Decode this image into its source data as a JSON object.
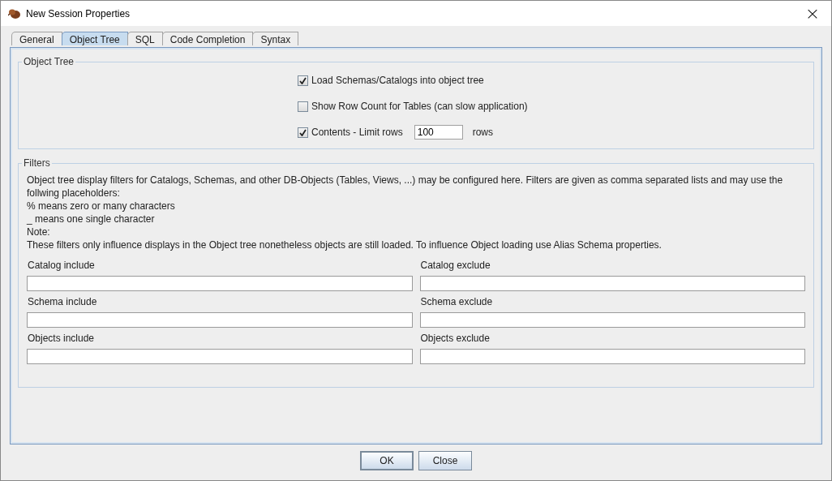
{
  "window": {
    "title": "New Session Properties",
    "close": "×"
  },
  "tabs": [
    {
      "label": "General",
      "selected": false
    },
    {
      "label": "Object Tree",
      "selected": true
    },
    {
      "label": "SQL",
      "selected": false
    },
    {
      "label": "Code Completion",
      "selected": false
    },
    {
      "label": "Syntax",
      "selected": false
    }
  ],
  "object_tree": {
    "title": "Object Tree",
    "options": [
      {
        "kind": "checkbox",
        "label": "Load Schemas/Catalogs into object tree",
        "checked": true
      },
      {
        "kind": "checkbox",
        "label": "Show Row Count for Tables (can slow application)",
        "checked": false
      },
      {
        "kind": "limit",
        "label": "Contents - Limit rows",
        "checked": true,
        "value": "100",
        "unit": "rows"
      }
    ]
  },
  "filters": {
    "title": "Filters",
    "description": [
      "Object tree display filters for Catalogs, Schemas, and other DB-Objects (Tables, Views, ...) may be configured here. Filters are given as comma separated lists and may use the follwing placeholders:",
      "% means zero or many characters",
      "_ means one single character",
      "Note:",
      "These filters only influence displays in the Object tree nonetheless objects are still loaded. To influence Object loading use Alias Schema properties."
    ],
    "fields": [
      {
        "label": "Catalog include"
      },
      {
        "label": "Catalog exclude"
      },
      {
        "label": "Schema include"
      },
      {
        "label": "Schema exclude"
      },
      {
        "label": "Objects include"
      },
      {
        "label": "Objects exclude"
      }
    ]
  },
  "buttons": [
    {
      "label": "OK",
      "default": true
    },
    {
      "label": "Close",
      "default": false
    }
  ]
}
